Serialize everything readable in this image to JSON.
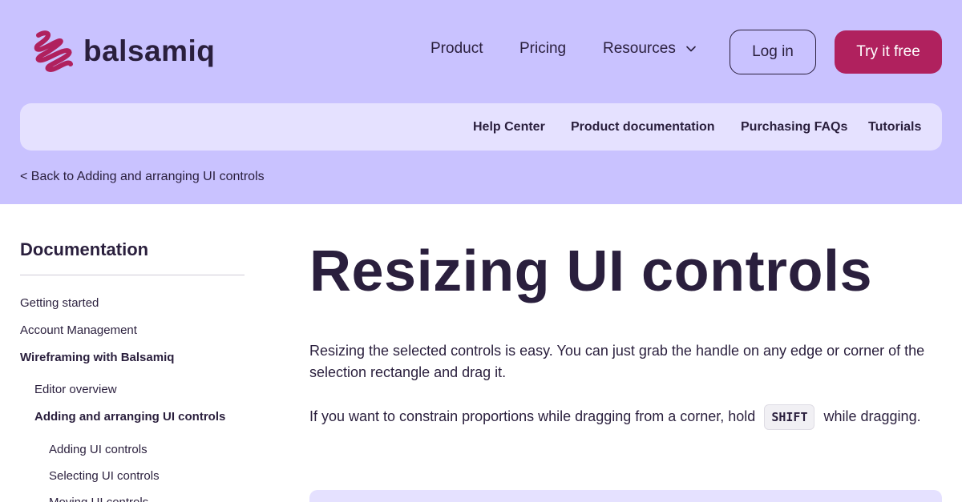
{
  "header": {
    "brand": "balsamiq",
    "nav": {
      "product": "Product",
      "pricing": "Pricing",
      "resources": "Resources"
    },
    "login_label": "Log in",
    "try_label": "Try it free"
  },
  "subnav": {
    "help": "Help Center",
    "docs": "Product documentation",
    "faq": "Purchasing FAQs",
    "tutorials": "Tutorials"
  },
  "breadcrumb": {
    "back": "< Back to Adding and arranging UI controls"
  },
  "sidebar": {
    "title": "Documentation",
    "items": [
      {
        "label": "Getting started"
      },
      {
        "label": "Account Management"
      },
      {
        "label": "Wireframing with Balsamiq"
      },
      {
        "label": "Editor overview"
      },
      {
        "label": "Adding and arranging UI controls"
      },
      {
        "label": "Adding UI controls"
      },
      {
        "label": "Selecting UI controls"
      },
      {
        "label": "Moving UI controls"
      }
    ]
  },
  "main": {
    "title": "Resizing UI controls",
    "para1": "Resizing the selected controls is easy. You can just grab the handle on any edge or corner of the selection rectangle and drag it.",
    "para2_before": "If you want to constrain proportions while dragging from a corner, hold",
    "para2_key": "SHIFT",
    "para2_after": "while dragging."
  },
  "colors": {
    "header_bg": "#c9c2ff",
    "subnav_bg": "#e5e1ff",
    "accent": "#b0215e",
    "text": "#2a1f3d"
  },
  "icons": {
    "logo": "balsamiq-scribble-icon",
    "resources_dropdown": "chevron-down-icon"
  }
}
